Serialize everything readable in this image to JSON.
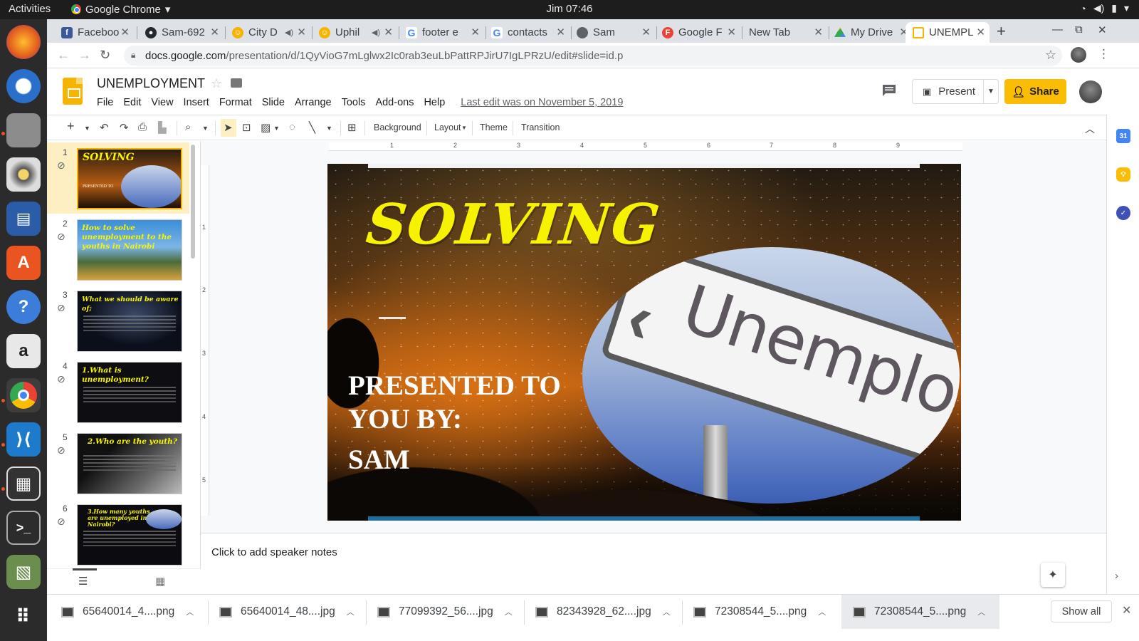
{
  "system": {
    "activities": "Activities",
    "app_name": "Google Chrome",
    "clock": "Jim 07:46"
  },
  "browser": {
    "tabs": [
      {
        "label": "Faceboo",
        "icon": "facebook-icon",
        "color": "#3b5998",
        "glyph": "f"
      },
      {
        "label": "Sam-692",
        "icon": "github-icon",
        "color": "#24292e",
        "glyph": "●"
      },
      {
        "label": "City D",
        "icon": "emoji-icon",
        "color": "#f4b400",
        "glyph": "☺"
      },
      {
        "label": "Uphil",
        "icon": "emoji-icon",
        "color": "#f4b400",
        "glyph": "☺"
      },
      {
        "label": "footer e",
        "icon": "google-icon",
        "color": "#4285f4",
        "glyph": "G"
      },
      {
        "label": "contacts",
        "icon": "google-icon",
        "color": "#4285f4",
        "glyph": "G"
      },
      {
        "label": "Sam",
        "icon": "globe-icon",
        "color": "#5f6368",
        "glyph": "◉"
      },
      {
        "label": "Google F",
        "icon": "forms-icon",
        "color": "#ea4335",
        "glyph": "F"
      },
      {
        "label": "New Tab",
        "icon": "",
        "color": "",
        "glyph": ""
      },
      {
        "label": "My Drive",
        "icon": "drive-icon",
        "color": "#34a853",
        "glyph": "▲"
      },
      {
        "label": "UNEMPL",
        "icon": "slides-icon",
        "color": "#f4b400",
        "glyph": "▭"
      }
    ],
    "url_host": "docs.google.com",
    "url_path": "/presentation/d/1QyVioG7mLglwx2Ic0rab3euLbPattRPJirU7IgLPRzU/edit#slide=id.p"
  },
  "doc": {
    "title": "UNEMPLOYMENT",
    "menus": [
      "File",
      "Edit",
      "View",
      "Insert",
      "Format",
      "Slide",
      "Arrange",
      "Tools",
      "Add-ons",
      "Help"
    ],
    "last_edit": "Last edit was on November 5, 2019",
    "present_label": "Present",
    "share_label": "Share"
  },
  "toolbar": {
    "background": "Background",
    "layout": "Layout",
    "theme": "Theme",
    "transition": "Transition"
  },
  "ruler": {
    "h": [
      "1",
      "2",
      "3",
      "4",
      "5",
      "6",
      "7",
      "8",
      "9"
    ],
    "v": [
      "1",
      "2",
      "3",
      "4",
      "5"
    ]
  },
  "filmstrip": [
    {
      "num": "1",
      "title": "SOLVING"
    },
    {
      "num": "2",
      "title": "How to solve unemployment to the youths in Nairobi"
    },
    {
      "num": "3",
      "title": "What we should be aware of;"
    },
    {
      "num": "4",
      "title": "1.What is unemployment?"
    },
    {
      "num": "5",
      "title": "2.Who are the youth?"
    },
    {
      "num": "6",
      "title": "3.How many youths are unemployed in Nairobi?"
    }
  ],
  "slide": {
    "title": "SOLVING",
    "presented_line1": "PRESENTED TO",
    "presented_line2": "YOU BY:",
    "name": "SAM",
    "sign_text": "Unemployment"
  },
  "notes_placeholder": "Click to add speaker notes",
  "downloads": {
    "items": [
      "65640014_4....png",
      "65640014_48....jpg",
      "77099392_56....jpg",
      "82343928_62....jpg",
      "72308544_5....png",
      "72308544_5....png"
    ],
    "show_all": "Show all"
  },
  "colors": {
    "accent_yellow": "#fbbc04",
    "slide_title_yellow": "#f6f200",
    "ubuntu_orange": "#e95420"
  }
}
